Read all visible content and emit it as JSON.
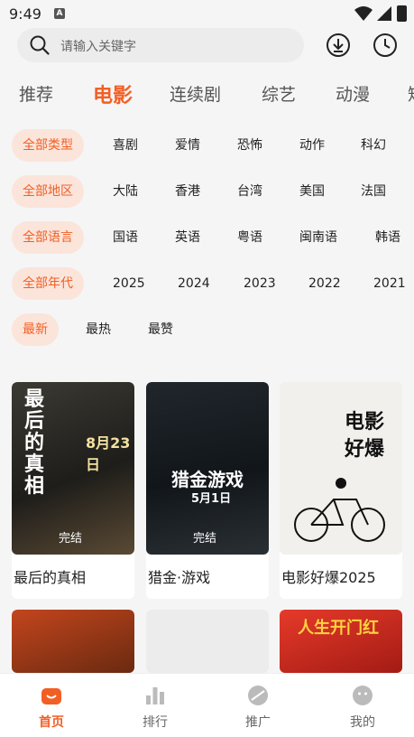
{
  "status_bar": {
    "time": "9:49",
    "notification_icon": "A"
  },
  "search": {
    "placeholder": "请输入关键字"
  },
  "header_icons": [
    "download-icon",
    "history-icon"
  ],
  "tabs": [
    {
      "label": "推荐",
      "active": false
    },
    {
      "label": "电影",
      "active": true
    },
    {
      "label": "连续剧",
      "active": false
    },
    {
      "label": "综艺",
      "active": false
    },
    {
      "label": "动漫",
      "active": false
    },
    {
      "label": "短",
      "active": false
    }
  ],
  "filters": {
    "type": [
      "全部类型",
      "喜剧",
      "爱情",
      "恐怖",
      "动作",
      "科幻"
    ],
    "region": [
      "全部地区",
      "大陆",
      "香港",
      "台湾",
      "美国",
      "法国"
    ],
    "language": [
      "全部语言",
      "国语",
      "英语",
      "粤语",
      "闽南语",
      "韩语"
    ],
    "year": [
      "全部年代",
      "2025",
      "2024",
      "2023",
      "2022",
      "2021"
    ],
    "sort": [
      "最新",
      "最热",
      "最赞"
    ]
  },
  "movies": [
    {
      "title": "最后的真相",
      "badge": "完结",
      "poster_text": "最后的真相",
      "poster_date": "8月23日"
    },
    {
      "title": "猎金·游戏",
      "badge": "完结",
      "poster_text": "猎金游戏",
      "poster_date": "5月1日"
    },
    {
      "title": "电影好爆2025",
      "badge": "",
      "poster_text": "电影好爆",
      "poster_date": ""
    },
    {
      "title": "",
      "badge": "",
      "poster_text": "",
      "poster_date": ""
    },
    {
      "title": "",
      "badge": "",
      "poster_text": "",
      "poster_date": ""
    },
    {
      "title": "",
      "badge": "",
      "poster_text": "人生开门红",
      "poster_date": ""
    }
  ],
  "bottom_nav": [
    {
      "label": "首页",
      "icon": "home-icon",
      "active": true
    },
    {
      "label": "排行",
      "icon": "ranking-icon",
      "active": false
    },
    {
      "label": "推广",
      "icon": "promote-icon",
      "active": false
    },
    {
      "label": "我的",
      "icon": "profile-icon",
      "active": false
    }
  ],
  "colors": {
    "accent": "#f25f24",
    "chip_bg": "#fbe4da",
    "background": "#f5f5f5"
  }
}
